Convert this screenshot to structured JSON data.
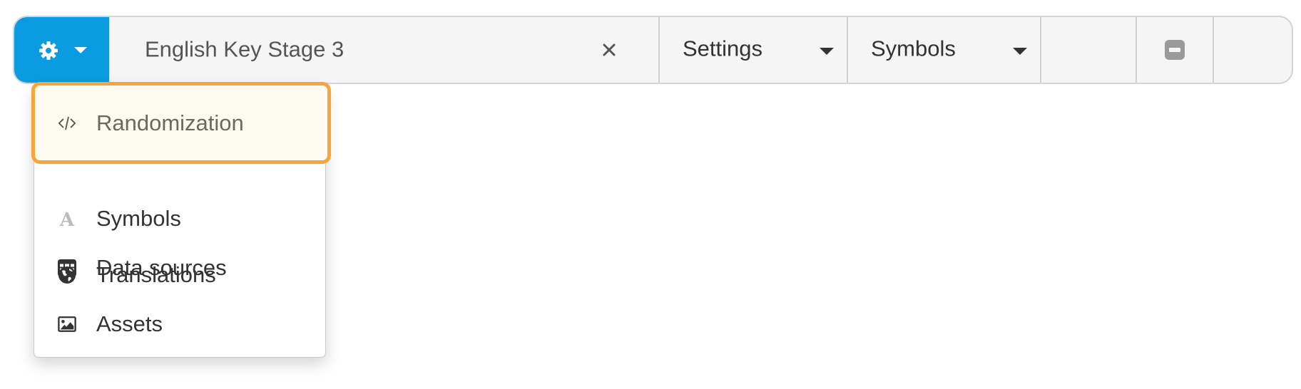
{
  "toolbar": {
    "gear_menu": {
      "icon": "gear-icon",
      "caret": "caret-down-icon",
      "accent_color": "#0a9be0"
    },
    "title": "English Key Stage 3",
    "clear_label": "×",
    "settings_label": "Settings",
    "symbols_label": "Symbols",
    "collapse_icon": "minus-square-icon"
  },
  "menu": {
    "highlight_color": "#f9a43a",
    "items": [
      {
        "label": "Randomization",
        "icon": "code-icon",
        "state": "highlighted"
      },
      {
        "label": "Symbols",
        "icon": "font-icon",
        "state": "disabled"
      },
      {
        "label": "Data sources",
        "icon": "table-icon",
        "state": "normal"
      },
      {
        "label": "Translations",
        "icon": "globe-icon",
        "state": "normal"
      },
      {
        "label": "Assets",
        "icon": "image-icon",
        "state": "normal"
      }
    ]
  }
}
